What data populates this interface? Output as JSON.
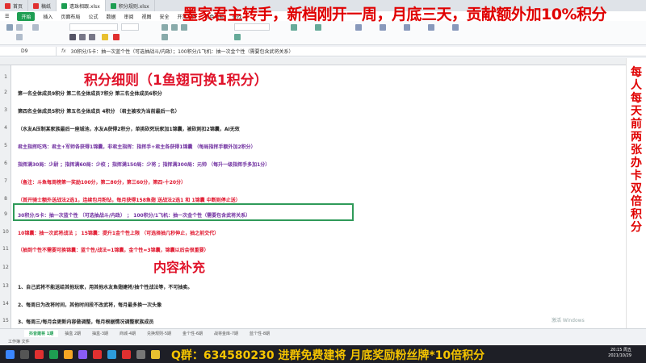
{
  "overlay": {
    "top_banner": "墨家君主转手，新档刚开一周，月底三天，贡献额外加10%积分",
    "side_vertical": "每人每天前两张办卡双倍积分",
    "bottom_banner": "Q群：634580230 进群免费建将 月底奖励粉丝牌*10倍积分"
  },
  "app_tabs": [
    {
      "label": "首页",
      "color": "#e03030"
    },
    {
      "label": "稿纸",
      "color": "#e03030"
    },
    {
      "label": "遗珠相跟.xlsx",
      "color": "#1e9e52"
    },
    {
      "label": "积分规则.xlsx",
      "color": "#1e9e52"
    }
  ],
  "menu": [
    "开始",
    "插入",
    "页面布局",
    "公式",
    "数据",
    "审阅",
    "视图",
    "安全",
    "开发工具",
    "特色功能",
    "查找"
  ],
  "formula_bar": {
    "cell_ref": "D9",
    "fx": "fx",
    "content": "30积分/5卡：抽一次蓝个性（可选抽战斗/内政）；100积分/1飞机：抽一次金个性（需要包含武将关系）"
  },
  "sheet": {
    "title": "积分细则（1鱼翅可换1积分）",
    "section2": "内容补充",
    "lines": [
      {
        "text": "第一名全体成员9积分   第二名全体成员7积分  第三名全体成员6积分",
        "color": "#222"
      },
      {
        "text": "第四名全体成员5积分  第五名全体成员 4积分  （君主被攻为当前最后一名）",
        "color": "#222",
        "accent": "（君主被攻为当前最后一名）"
      },
      {
        "text": "（水友A压制某家族最后一座城池，水友A获得2积分，单挑砍死玩家加1锦囊，被砍则扣2锦囊，AI无效",
        "color": "#222"
      },
      {
        "text": "君主指挥吃鸡：君主+军师各获得1锦囊，非君主指挥：指挥手+君主各获得1锦囊 （每局指挥手额外加2积分）",
        "color": "#7030a0"
      },
      {
        "text": "指挥满30局：少尉 ；指挥满60局：少校 ；指挥满150局：少将 ；指挥满300局：元帅 （每升一级指挥手多加1分）",
        "color": "#7030a0"
      },
      {
        "text": "（备注：斗鱼每周榜第一奖励100分，第二80分，第三60分，第四-十20分）",
        "color": "#e0132a"
      },
      {
        "text": "（首开骑士额外送战法2选1，连续包月粉钻，每月获得158鱼翅 送战法2选1 和 1锦囊 中断则停止送）",
        "color": "#e0132a"
      },
      {
        "text": "30积分/5卡：抽一次蓝个性 （可选抽战斗/内政）    ；   100积分/1飞机：抽一次金个性（需要包含武将关系）",
        "color": "#7030a0"
      },
      {
        "text": "10锦囊：抽一次武将战法 ；  15锦囊：提升1金个性上限 （可选择抽几秒伸止，抽之前交代）",
        "color": "#e0132a"
      },
      {
        "text": "（抽到个性不需要可换锦囊：蓝个性/战法=1锦囊，金个性=3锦囊，锦囊以后会很重要）",
        "color": "#e0132a"
      },
      {
        "text": "1、自己武将不能送给其他玩家，用其他水友鱼翅建将/抽个性战法等，不可抽卖。",
        "color": "#222"
      },
      {
        "text": "2、每周日为改将时间，其他时间段不改武将，每月最多换一次头像",
        "color": "#222"
      },
      {
        "text": "3、每周三/每月会更新内容做调整，每月根据情况调整家族成员",
        "color": "#222"
      }
    ],
    "row_numbers": [
      "1",
      "2",
      "3",
      "4",
      "5",
      "6",
      "7",
      "8",
      "9",
      "10",
      "11",
      "12",
      "13",
      "14",
      "15"
    ]
  },
  "sheet_tabs": [
    "抖音建将 1期",
    "抽盒 2期",
    "抽盒-3期",
    "商城-4期",
    "兑换规则-5期",
    "金个性-6期",
    "战将金库-7期",
    "蓝个性-8期"
  ],
  "status_bar": "  工作簿 文件 ",
  "watermark": "激活 Windows",
  "clock": {
    "time": "20:15 周五",
    "date": "2021/10/29"
  }
}
